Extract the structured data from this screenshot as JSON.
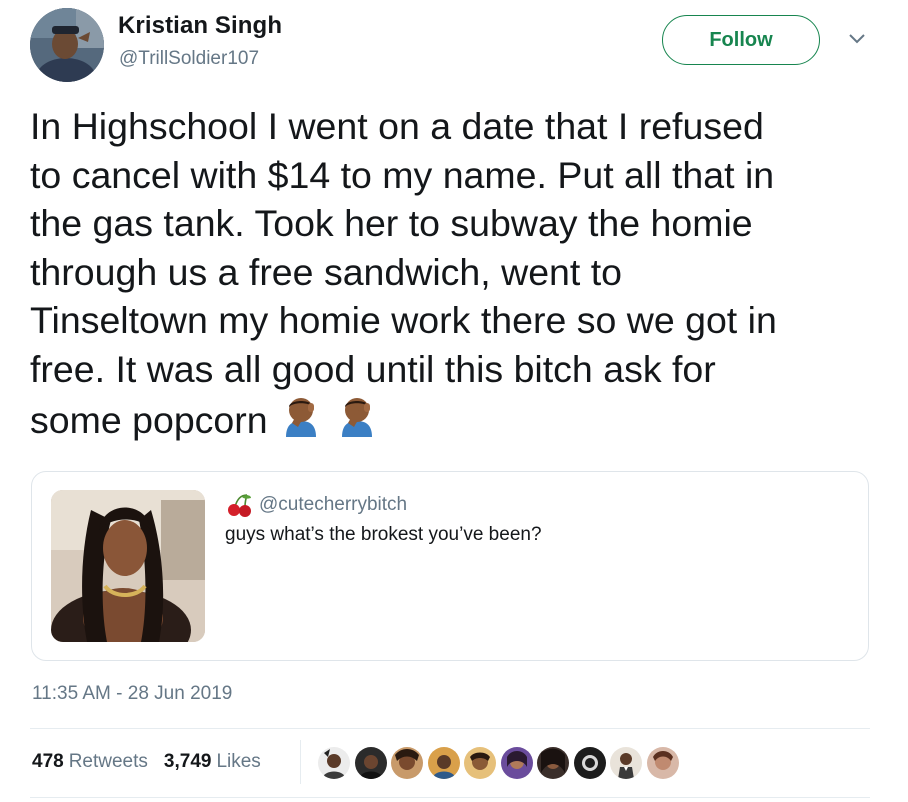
{
  "author": {
    "name": "Kristian Singh",
    "handle": "@TrillSoldier107"
  },
  "follow_label": "Follow",
  "tweet_lines": [
    "In Highschool I went on a date that I refused",
    "to cancel with $14 to my name. Put all that in",
    "the gas tank. Took her to subway the homie",
    "through us a free sandwich, went to",
    "Tinseltown my homie work there so we got in",
    "free. It was all good until this bitch ask for",
    "some popcorn"
  ],
  "tweet_emoji": [
    "facepalm-emoji",
    "facepalm-emoji"
  ],
  "quoted": {
    "handle": "@cutecherrybitch",
    "handle_icon": "cherry-icon",
    "text": "guys what’s the brokest you’ve been?"
  },
  "timestamp": "11:35 AM - 28 Jun 2019",
  "stats": {
    "retweets_count": "478",
    "retweets_label": "Retweets",
    "likes_count": "3,749",
    "likes_label": "Likes"
  },
  "liker_avatars": [
    "liker-avatar-1",
    "liker-avatar-2",
    "liker-avatar-3",
    "liker-avatar-4",
    "liker-avatar-5",
    "liker-avatar-6",
    "liker-avatar-7",
    "liker-avatar-8",
    "liker-avatar-9",
    "liker-avatar-10"
  ],
  "colors": {
    "follow_green": "#17854f",
    "secondary_text": "#657786",
    "primary_text": "#14171a",
    "border": "#dfe5ea"
  }
}
